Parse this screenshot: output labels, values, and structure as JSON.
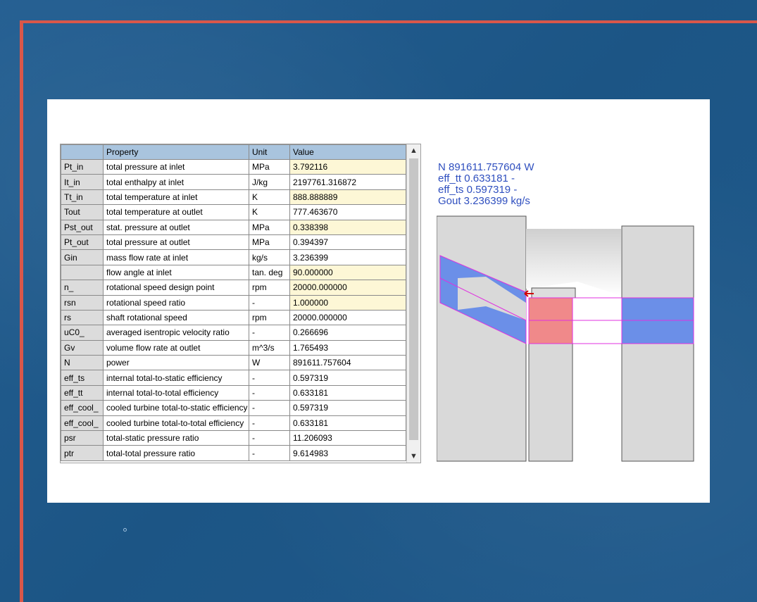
{
  "table": {
    "headers": [
      "",
      "Property",
      "Unit",
      "Value"
    ],
    "rows": [
      {
        "name": "Pt_in",
        "property": "total pressure at inlet",
        "unit": "MPa",
        "value": "3.792116",
        "editable": true
      },
      {
        "name": "It_in",
        "property": "total enthalpy at inlet",
        "unit": "J/kg",
        "value": "2197761.316872",
        "editable": false
      },
      {
        "name": "Tt_in",
        "property": "total temperature at inlet",
        "unit": "K",
        "value": "888.888889",
        "editable": true
      },
      {
        "name": "Tout",
        "property": "total temperature at outlet",
        "unit": "K",
        "value": "777.463670",
        "editable": false
      },
      {
        "name": "Pst_out",
        "property": "stat. pressure at outlet",
        "unit": "MPa",
        "value": "0.338398",
        "editable": true
      },
      {
        "name": "Pt_out",
        "property": "total pressure at outlet",
        "unit": "MPa",
        "value": "0.394397",
        "editable": false
      },
      {
        "name": "Gin",
        "property": "mass flow rate at inlet",
        "unit": "kg/s",
        "value": "3.236399",
        "editable": false
      },
      {
        "name": "",
        "property": "flow angle at inlet",
        "unit": "tan. deg",
        "value": "90.000000",
        "editable": true
      },
      {
        "name": "n_",
        "property": "rotational speed design point",
        "unit": "rpm",
        "value": "20000.000000",
        "editable": true
      },
      {
        "name": "rsn",
        "property": "rotational speed ratio",
        "unit": "-",
        "value": "1.000000",
        "editable": true
      },
      {
        "name": "rs",
        "property": "shaft rotational speed",
        "unit": "rpm",
        "value": "20000.000000",
        "editable": false
      },
      {
        "name": "uC0_",
        "property": "averaged isentropic velocity ratio",
        "unit": "-",
        "value": "0.266696",
        "editable": false
      },
      {
        "name": "Gv",
        "property": "volume flow rate at outlet",
        "unit": "m^3/s",
        "value": "1.765493",
        "editable": false
      },
      {
        "name": "N",
        "property": "power",
        "unit": "W",
        "value": "891611.757604",
        "editable": false
      },
      {
        "name": "eff_ts",
        "property": "internal total-to-static efficiency",
        "unit": "-",
        "value": "0.597319",
        "editable": false
      },
      {
        "name": "eff_tt",
        "property": "internal total-to-total efficiency",
        "unit": "-",
        "value": "0.633181",
        "editable": false
      },
      {
        "name": "eff_cool_",
        "property": "cooled turbine total-to-static efficiency",
        "unit": "-",
        "value": "0.597319",
        "editable": false
      },
      {
        "name": "eff_cool_",
        "property": "cooled turbine total-to-total efficiency",
        "unit": "-",
        "value": "0.633181",
        "editable": false
      },
      {
        "name": "psr",
        "property": "total-static pressure ratio",
        "unit": "-",
        "value": "11.206093",
        "editable": false
      },
      {
        "name": "ptr",
        "property": "total-total pressure ratio",
        "unit": "-",
        "value": "9.614983",
        "editable": false
      }
    ]
  },
  "scroll": {
    "up_icon": "▲",
    "down_icon": "▼"
  },
  "results": {
    "line1": "N 891611.757604 W",
    "line2": "eff_tt 0.633181 -",
    "line3": "eff_ts 0.597319 -",
    "line4": "Gout 3.236399 kg/s"
  },
  "colors": {
    "frame": "#d9574a",
    "background": "#1f5d8f",
    "header": "#a9c4de",
    "editable": "#fdf7d6",
    "result_text": "#2f4fbf",
    "flow_blue": "#6b8fe8",
    "flow_red": "#f0898a",
    "outline": "#e030e0"
  }
}
